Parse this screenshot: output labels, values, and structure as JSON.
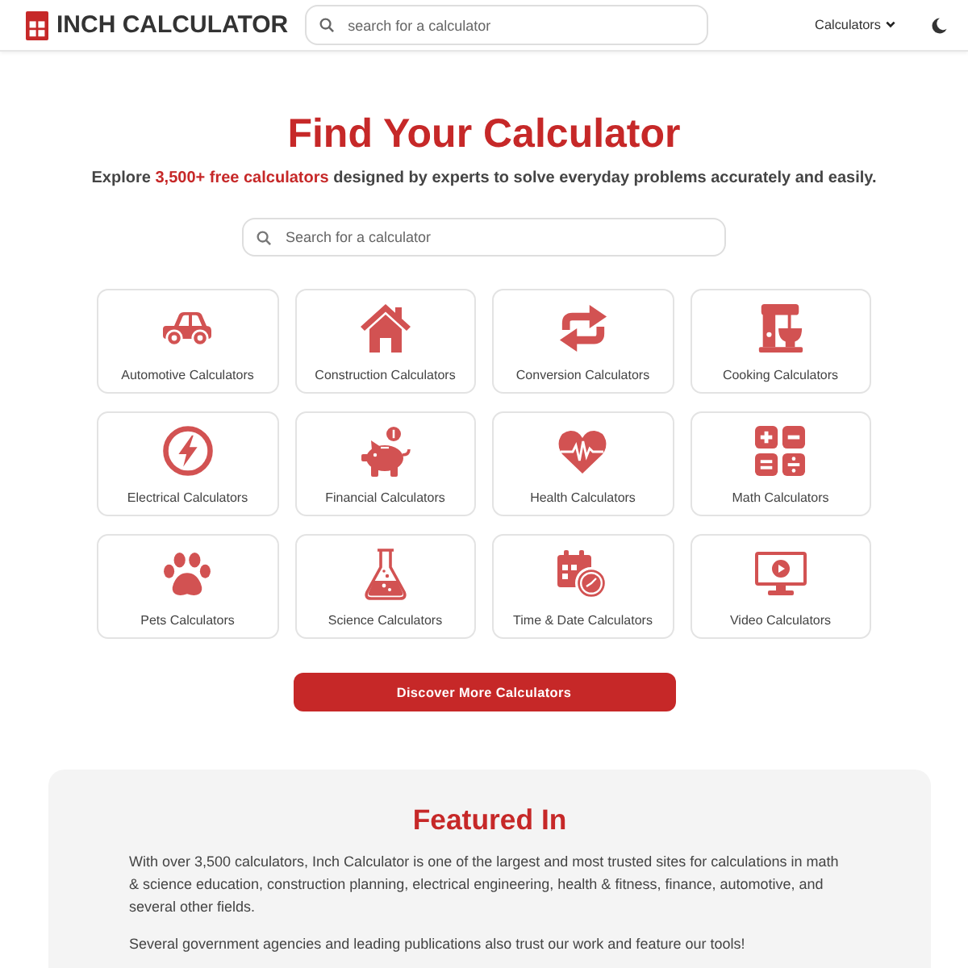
{
  "header": {
    "logo_text": "INCH CALCULATOR",
    "search": {
      "placeholder": "search for a calculator"
    },
    "nav_menu": "Calculators"
  },
  "hero": {
    "title": "Find Your Calculator",
    "subtitle": {
      "before": "Explore",
      "link": "3,500+ free calculators",
      "after": "designed by experts to solve everyday problems accurately and easily."
    },
    "search": {
      "placeholder": "Search for a calculator"
    }
  },
  "categories": [
    "Automotive Calculators",
    "Construction Calculators",
    "Conversion Calculators",
    "Cooking Calculators",
    "Electrical Calculators",
    "Financial Calculators",
    "Health Calculators",
    "Math Calculators",
    "Pets Calculators",
    "Science Calculators",
    "Time & Date Calculators",
    "Video Calculators"
  ],
  "discover_button": "Discover More Calculators",
  "featured": {
    "title": "Featured In",
    "paragraphs": [
      "With over 3,500 calculators, Inch Calculator is one of the largest and most trusted sites for calculations in math & science education, construction planning, electrical engineering, health & fitness, finance, automotive, and several other fields.",
      "Several government agencies and leading publications also trust our work and feature our tools!"
    ]
  }
}
